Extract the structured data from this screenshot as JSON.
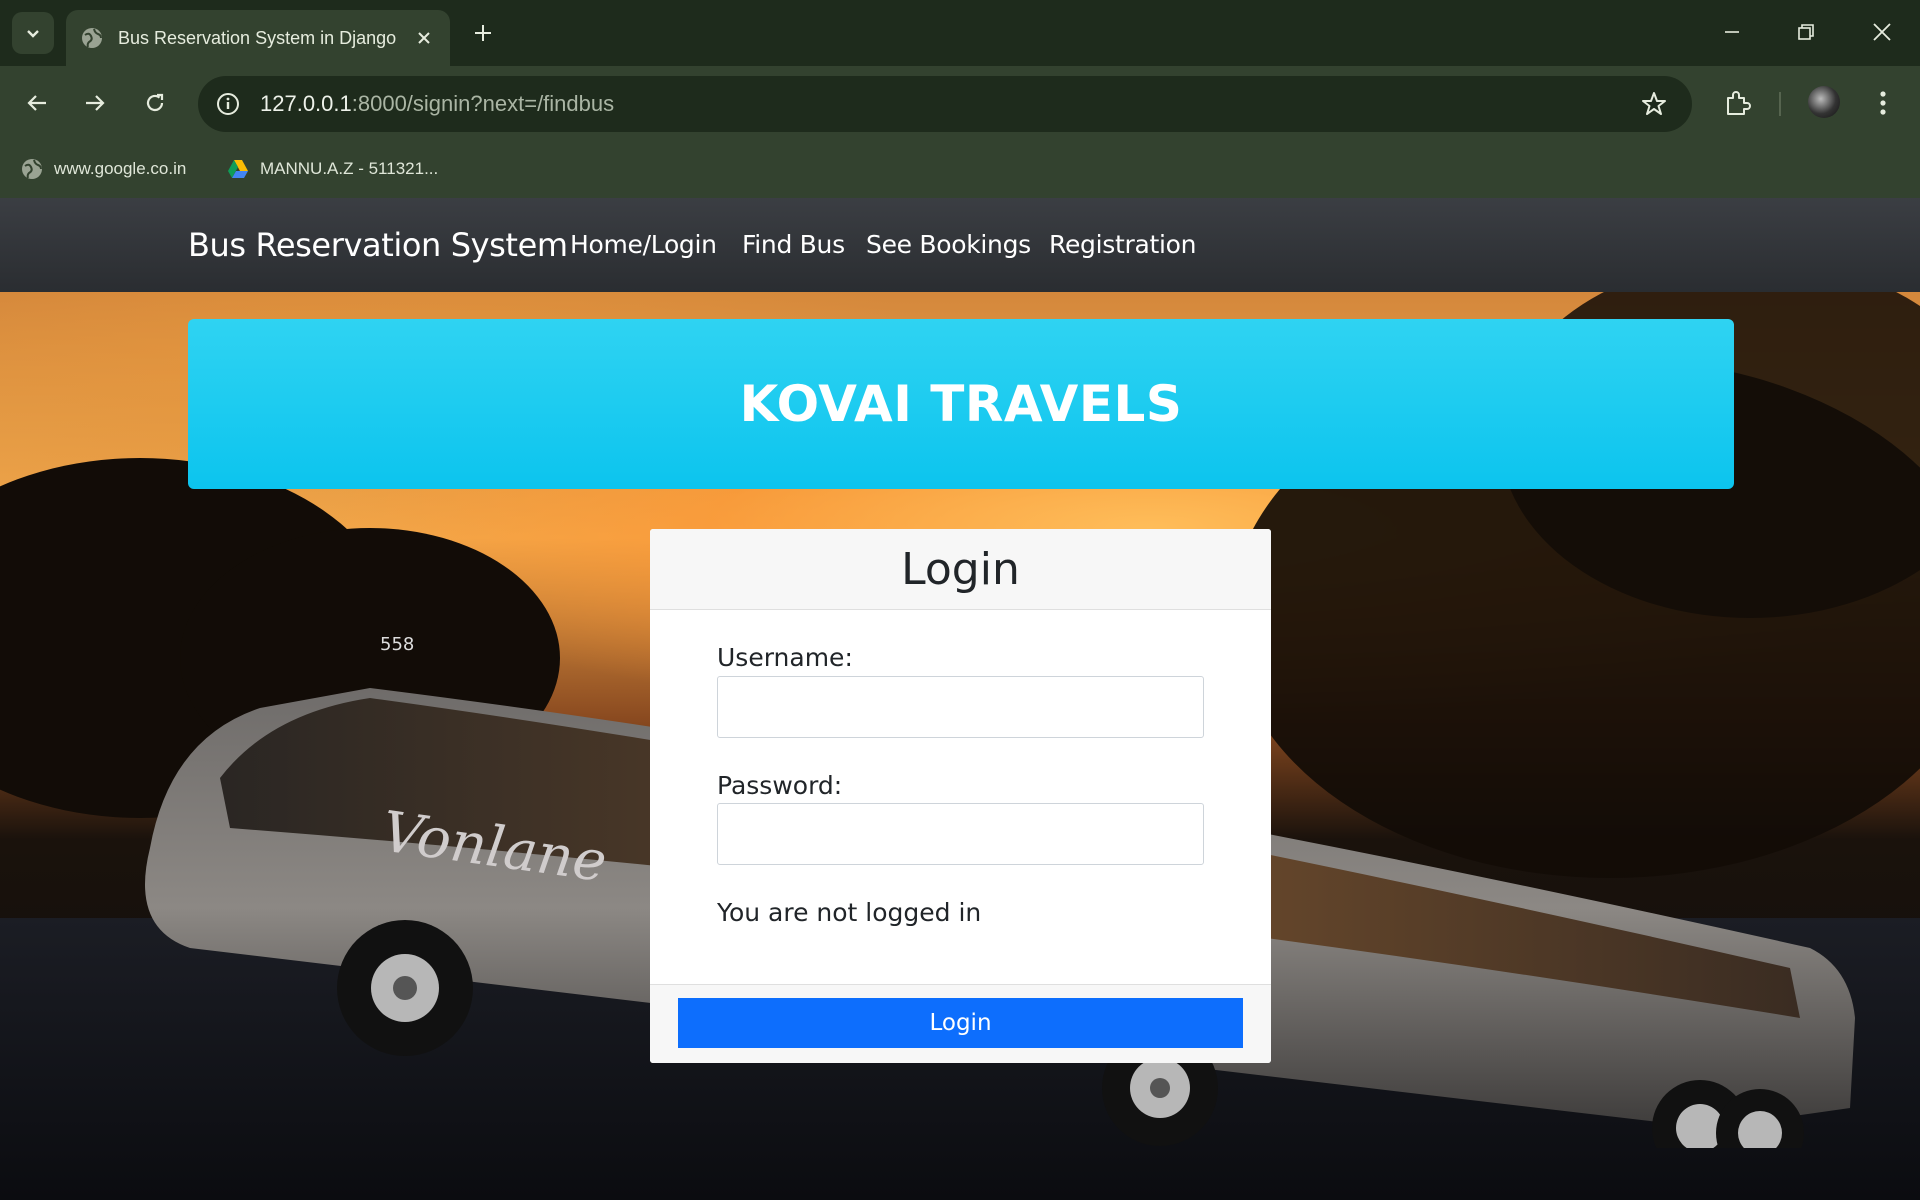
{
  "browser": {
    "tab_title": "Bus Reservation System in Django",
    "url_host": "127.0.0.1",
    "url_rest": ":8000/signin?next=/findbus",
    "bookmarks": [
      {
        "label": "www.google.co.in",
        "icon": "globe-icon"
      },
      {
        "label": "MANNU.A.Z - 511321...",
        "icon": "google-drive-icon"
      }
    ]
  },
  "navbar": {
    "brand": "Bus Reservation System",
    "links": [
      "Home/Login",
      "Find Bus",
      "See Bookings",
      "Registration"
    ]
  },
  "banner": {
    "title": "KOVAI TRAVELS",
    "color": "#0dcaf0"
  },
  "login": {
    "title": "Login",
    "username_label": "Username:",
    "username_value": "",
    "password_label": "Password:",
    "password_value": "",
    "status": "You are not logged in",
    "button": "Login",
    "button_color": "#0d6efd"
  },
  "scene": {
    "bus_number": "558",
    "bus_logo_text": "Vonlane"
  }
}
